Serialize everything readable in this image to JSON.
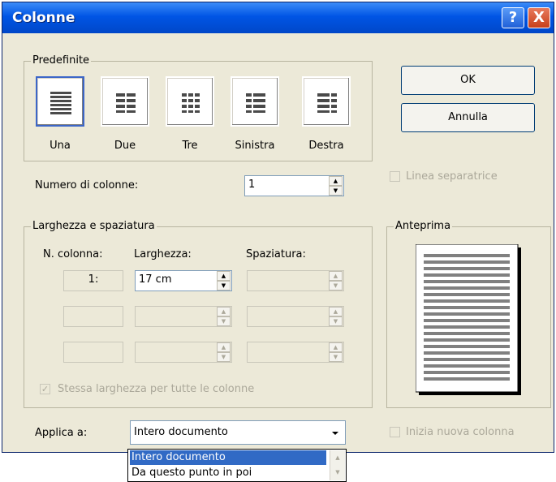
{
  "window": {
    "title": "Colonne",
    "help_label": "?",
    "close_label": "X"
  },
  "presets": {
    "legend": "Predefinite",
    "items": [
      {
        "label": "Una"
      },
      {
        "label": "Due"
      },
      {
        "label": "Tre"
      },
      {
        "label": "Sinistra"
      },
      {
        "label": "Destra"
      }
    ]
  },
  "buttons": {
    "ok": "OK",
    "cancel": "Annulla"
  },
  "num_columns": {
    "label": "Numero di colonne:",
    "value": "1"
  },
  "separator": {
    "label": "Linea separatrice",
    "checked": false
  },
  "width_spacing": {
    "legend": "Larghezza e spaziatura",
    "col_header": "N. colonna:",
    "width_header": "Larghezza:",
    "spacing_header": "Spaziatura:",
    "rows": [
      {
        "col": "1:",
        "width": "17 cm",
        "spacing": ""
      },
      {
        "col": "",
        "width": "",
        "spacing": ""
      },
      {
        "col": "",
        "width": "",
        "spacing": ""
      }
    ],
    "equal_width_label": "Stessa larghezza per tutte le colonne",
    "equal_width_checked": true
  },
  "preview": {
    "legend": "Anteprima"
  },
  "apply": {
    "label": "Applica a:",
    "value": "Intero documento",
    "options": [
      "Intero documento",
      "Da questo punto in poi"
    ]
  },
  "new_column": {
    "label": "Inizia nuova colonna",
    "checked": false
  },
  "colors": {
    "titlebar": "#0055E5",
    "dialog_bg": "#ECE9D8",
    "selection": "#316AC5"
  }
}
